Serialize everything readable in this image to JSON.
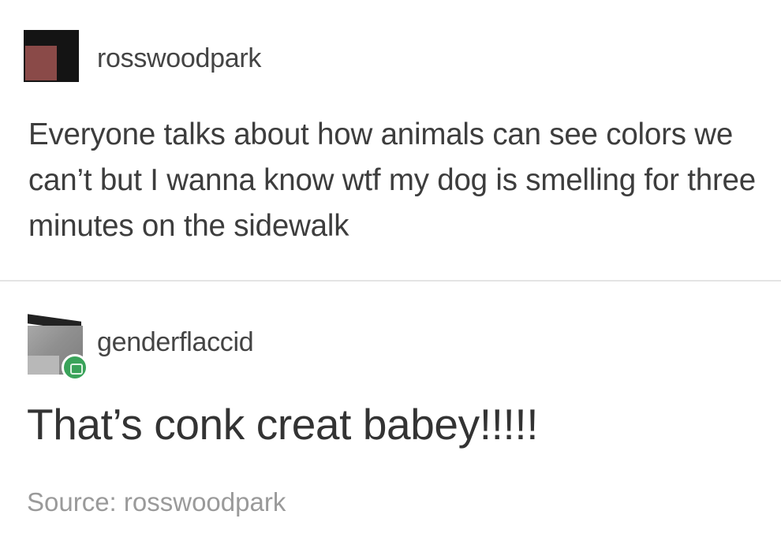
{
  "posts": [
    {
      "username": "rosswoodpark",
      "avatar_color": "#8a4a48",
      "text": "Everyone talks about how animals can see colors we can’t but I wanna know wtf my dog is smelling for three minutes on the sidewalk"
    },
    {
      "username": "genderflaccid",
      "avatar_color": "#909090",
      "badge_color": "#3aa35a",
      "text": "That’s conk creat babey!!!!!"
    }
  ],
  "source": {
    "label": "Source: rosswoodpark"
  }
}
